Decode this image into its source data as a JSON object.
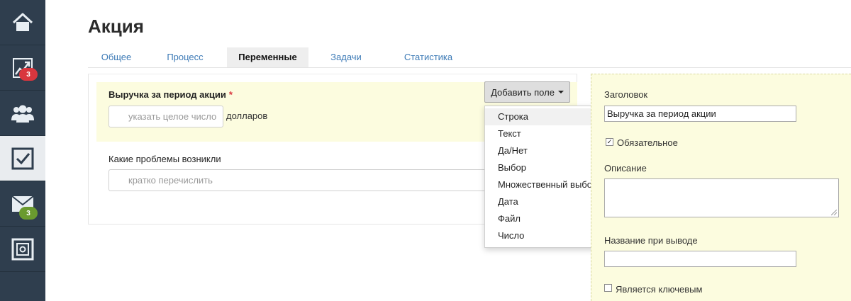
{
  "sidebar": {
    "items": [
      {
        "icon": "home-icon",
        "badge": ""
      },
      {
        "icon": "chart-icon",
        "badge": "3",
        "badge_color": "#d9363e"
      },
      {
        "icon": "users-icon",
        "badge": ""
      },
      {
        "icon": "tasks-checkbox-icon",
        "badge": ""
      },
      {
        "icon": "mail-icon",
        "badge": "3",
        "badge_color": "#6a9a2f"
      },
      {
        "icon": "safe-icon",
        "badge": ""
      }
    ]
  },
  "page": {
    "title": "Акция"
  },
  "tabs": [
    {
      "label": "Общее",
      "active": false
    },
    {
      "label": "Процесс",
      "active": false
    },
    {
      "label": "Переменные",
      "active": true
    },
    {
      "label": "Задачи",
      "active": false
    },
    {
      "label": "Статистика",
      "active": false
    }
  ],
  "form": {
    "field1": {
      "label": "Выручка за период акции",
      "required_mark": "*",
      "placeholder": "указать целое число",
      "unit": "долларов"
    },
    "field2": {
      "label": "Какие проблемы возникли",
      "placeholder": "кратко перечислить"
    },
    "add_field_button": "Добавить поле"
  },
  "dropdown": {
    "items": [
      "Строка",
      "Текст",
      "Да/Нет",
      "Выбор",
      "Множественный выбор",
      "Дата",
      "Файл",
      "Число"
    ],
    "highlighted_index": 0
  },
  "properties": {
    "title_label": "Заголовок",
    "title_value": "Выручка за период акции",
    "required_label": "Обязательное",
    "required_checked": true,
    "description_label": "Описание",
    "description_value": "",
    "display_name_label": "Название при выводе",
    "display_name_value": "",
    "key_label": "Является ключевым",
    "key_checked": false
  },
  "colors": {
    "sidebar_bg": "#2f3e4e",
    "link_blue": "#3c7ab6",
    "highlight_yellow": "#fcfcdf",
    "required_red": "#d9363e"
  }
}
